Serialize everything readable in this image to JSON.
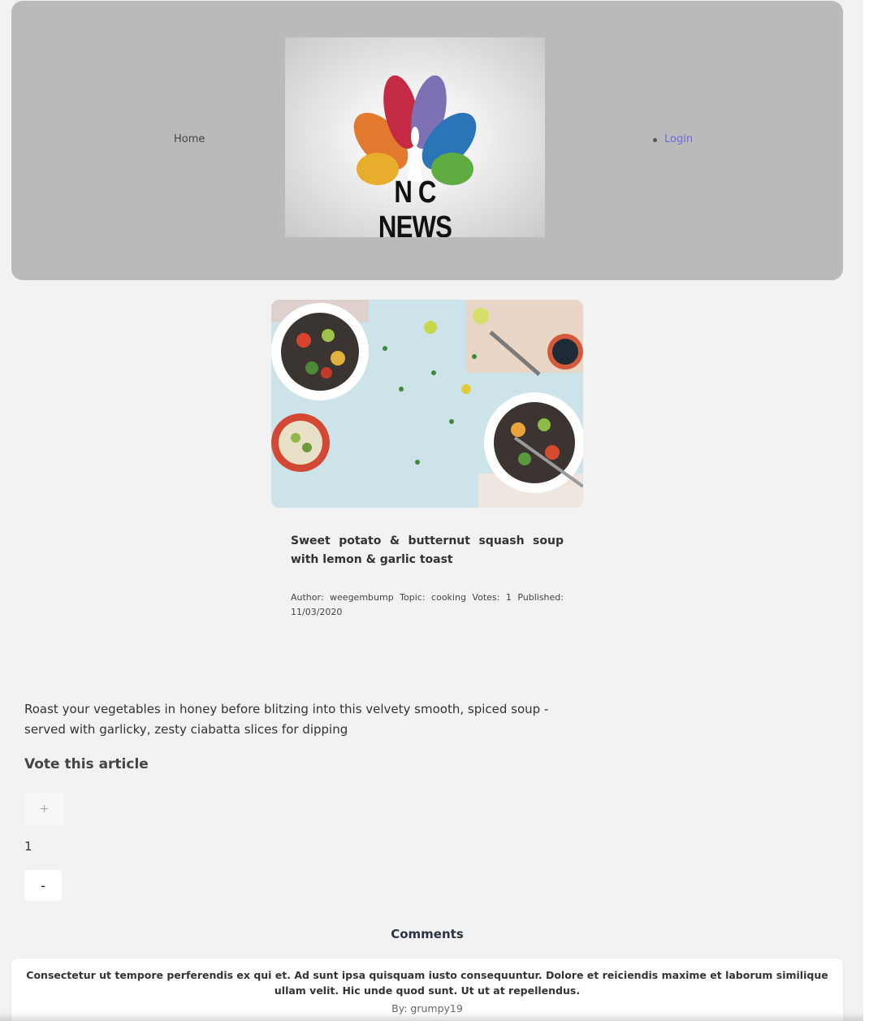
{
  "header": {
    "nav_left": {
      "home_label": "Home"
    },
    "logo": {
      "wordmark": "N  C NEWS",
      "name": "NBC News peacock logo"
    },
    "nav_right": {
      "items": [
        {
          "label": "Login"
        }
      ]
    }
  },
  "article": {
    "image": {
      "icon": "food-bowls-photo"
    },
    "title": "Sweet potato & butternut squash soup with lemon & garlic toast",
    "meta": "Author: weegembump Topic: cooking Votes: 1 Published: 11/03/2020",
    "body": "Roast your vegetables in honey before blitzing into this velvety smooth, spiced soup - served with garlicky, zesty ciabatta slices for dipping"
  },
  "vote": {
    "heading": "Vote this article",
    "up_label": "+",
    "count": "1",
    "down_label": "-"
  },
  "comments": {
    "heading": "Comments",
    "items": [
      {
        "body": "Consectetur ut tempore perferendis ex qui et. Ad sunt ipsa quisquam iusto consequuntur. Dolore et reiciendis maxime et laborum similique ullam velit. Hic unde quod sunt. Ut ut at repellendus.",
        "author": "By: grumpy19"
      }
    ]
  },
  "colors": {
    "header_bg": "#bababa",
    "page_bg": "#f2f2f2",
    "link": "#6b6bdc"
  }
}
